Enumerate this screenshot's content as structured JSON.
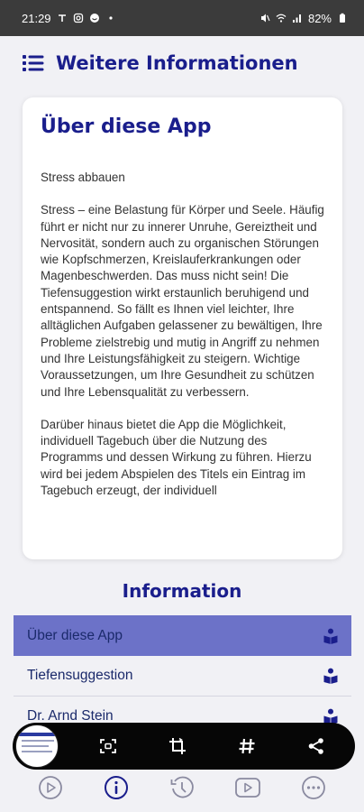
{
  "status_bar": {
    "time": "21:29",
    "battery": "82%"
  },
  "header": {
    "menu_icon": "menu-list-icon",
    "title": "Weitere Informationen"
  },
  "card": {
    "title": "Über diese App",
    "paragraphs": [
      "Stress abbauen",
      "Stress – eine Belastung für Körper und Seele. Häufig führt er nicht nur zu innerer Unruhe, Gereiztheit und Nervosität, sondern auch zu organischen Störungen wie Kopfschmerzen, Kreislauferkrankungen oder Magenbeschwerden. Das muss nicht sein! Die Tiefensuggestion wirkt erstaunlich beruhigend und entspannend. So fällt es Ihnen viel leichter, Ihre alltäglichen Aufgaben gelassener zu bewältigen, Ihre Probleme zielstrebig und mutig in Angriff zu nehmen und Ihre Leistungsfähigkeit zu steigern. Wichtige Voraussetzungen, um Ihre Gesundheit zu schützen und Ihre Lebensqualität zu verbessern.",
      "Darüber hinaus bietet die App die Möglichkeit, individuell Tagebuch über die Nutzung des Programms und dessen Wirkung zu führen. Hierzu wird bei jedem Abspielen des Titels ein Eintrag im Tagebuch erzeugt, der individuell"
    ]
  },
  "information": {
    "title": "Information",
    "items": [
      {
        "label": "Über diese App",
        "icon": "book-reader-icon",
        "active": true
      },
      {
        "label": "Tiefensuggestion",
        "icon": "book-reader-icon",
        "active": false
      },
      {
        "label": "Dr. Arnd Stein",
        "icon": "book-reader-icon",
        "active": false
      }
    ]
  },
  "floating_toolbar": {
    "buttons": [
      "screenshot-scan-icon",
      "crop-rotate-icon",
      "hashtag-icon",
      "share-icon"
    ]
  },
  "bottom_nav": {
    "items": [
      "play-circle-icon",
      "info-circle-icon",
      "history-icon",
      "video-play-icon",
      "more-circle-icon"
    ],
    "active": "info-circle-icon"
  },
  "colors": {
    "accent": "#1a1e8c",
    "active_item": "#6c72c8",
    "background": "#f1f1f5",
    "statusbar": "#3b3b3b"
  }
}
